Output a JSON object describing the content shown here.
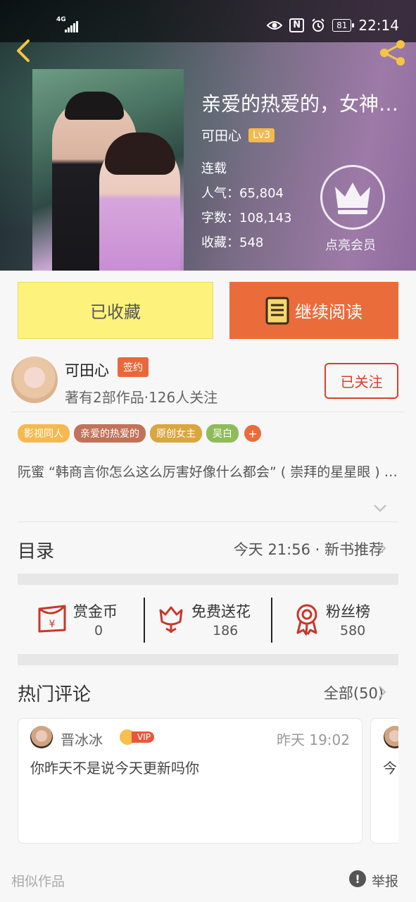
{
  "status_bar": {
    "network": "4G",
    "nfc": "N",
    "battery": "81",
    "time": "22:14"
  },
  "book": {
    "title": "亲爱的热爱的，女神…",
    "author": "可田心",
    "author_level": "Lv3",
    "status": "连载",
    "popularity_label": "人气",
    "popularity": "65,804",
    "word_count_label": "字数",
    "word_count": "108,143",
    "favorites_label": "收藏",
    "favorites": "548",
    "member_label": "点亮会员"
  },
  "actions": {
    "favorited": "已收藏",
    "continue_reading": "继续阅读"
  },
  "author_card": {
    "name": "可田心",
    "badge": "签约",
    "stats": "著有2部作品·126人关注",
    "follow": "已关注"
  },
  "tags": [
    {
      "label": "影视同人",
      "color": "#f4b94f"
    },
    {
      "label": "亲爱的热爱的",
      "color": "#c2725a"
    },
    {
      "label": "原创女主",
      "color": "#d9a640"
    },
    {
      "label": "吴白",
      "color": "#8fbc5a"
    }
  ],
  "tag_more": "+",
  "intro": "阮蜜 “韩商言你怎么这么厉害好像什么都会” ( 崇拜的星星眼 ) …",
  "toc": {
    "label": "目录",
    "update": "今天 21:56 · 新书推荐"
  },
  "stats": [
    {
      "label": "赏金币",
      "value": "0",
      "icon": "red-envelope-icon"
    },
    {
      "label": "免费送花",
      "value": "186",
      "icon": "flower-icon"
    },
    {
      "label": "粉丝榜",
      "value": "580",
      "icon": "medal-icon"
    }
  ],
  "comments": {
    "title": "热门评论",
    "all": "全部(50)",
    "items": [
      {
        "user": "晋冰冰",
        "vip": "VIP",
        "time": "昨天 19:02",
        "text": "你昨天不是说今天更新吗你"
      },
      {
        "text": "今"
      }
    ]
  },
  "footer": {
    "similar": "相似作品",
    "report_icon": "!",
    "report": "举报"
  },
  "colors": {
    "accent_orange": "#ea6c3a",
    "favorite_yellow": "#fdf27c",
    "follow_red": "#d7402b",
    "icon_red": "#c8372a"
  }
}
